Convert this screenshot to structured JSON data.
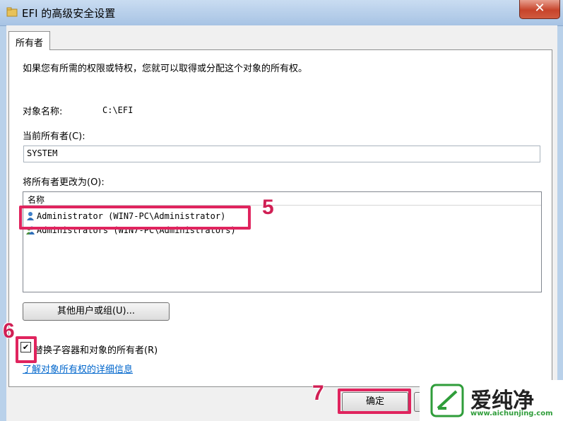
{
  "window": {
    "title": "EFI 的高级安全设置",
    "close_label": "✕"
  },
  "tabs": [
    {
      "label": "所有者"
    }
  ],
  "main": {
    "intro": "如果您有所需的权限或特权，您就可以取得或分配这个对象的所有权。",
    "object_name_label": "对象名称:",
    "object_name_value": "C:\\EFI",
    "current_owner_label": "当前所有者(C):",
    "current_owner_value": "SYSTEM",
    "change_owner_label": "将所有者更改为(O):",
    "list_header": "名称",
    "list_items": [
      {
        "label": "Administrator (WIN7-PC\\Administrator)",
        "icon": "user-icon"
      },
      {
        "label": "Administrators (WIN7-PC\\Administrators)",
        "icon": "group-icon"
      }
    ],
    "other_users_button": "其他用户或组(U)...",
    "replace_owner_checkbox": {
      "label": "替换子容器和对象的所有者(R)",
      "checked": true
    },
    "learn_more_link": "了解对象所有权的详细信息",
    "ok_button": "确定"
  },
  "annotations": {
    "step5": "5",
    "step6": "6",
    "step7": "7"
  },
  "watermark": {
    "brand": "爱纯净",
    "url": "www.aichunjing.com"
  },
  "colors": {
    "highlight": "#e0245e",
    "link": "#0066cc",
    "brand_green": "#2f9d3a"
  }
}
